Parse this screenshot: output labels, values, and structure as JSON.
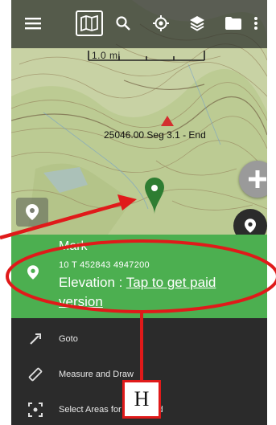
{
  "toolbar": {
    "icons": [
      "menu-icon",
      "map-icon",
      "search-icon",
      "locate-icon",
      "layers-icon",
      "folder-icon",
      "more-icon"
    ]
  },
  "map": {
    "scale_label": "1.0 mi",
    "segment_label": "25046.00 Seg 3.1 - End"
  },
  "info_panel": {
    "title": "Mark",
    "coords": "10 T 452843 4947200",
    "elevation_prefix": "Elevation : ",
    "elevation_link": "Tap to get paid",
    "elevation_link_cont": "version"
  },
  "menu": {
    "items": [
      {
        "label": "Goto",
        "icon": "goto-icon"
      },
      {
        "label": "Measure and Draw",
        "icon": "ruler-icon"
      },
      {
        "label": "Select Areas for Download",
        "icon": "select-area-icon"
      }
    ]
  },
  "annotation": {
    "label": "H",
    "color": "#e01a1a"
  },
  "colors": {
    "panel": "#4caf50",
    "menu_bg": "#2b2b2b",
    "marker": "#2e7d32",
    "waypoint": "#d32f2f"
  }
}
